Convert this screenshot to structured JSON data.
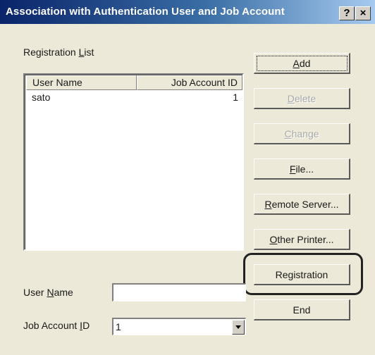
{
  "window": {
    "title": "Association with Authentication User and Job Account",
    "help_symbol": "?",
    "close_symbol": "×"
  },
  "registration_list": {
    "label_pre": "Registration ",
    "label_accel": "L",
    "label_post": "ist",
    "columns": [
      "User Name",
      "Job Account ID"
    ],
    "rows": [
      {
        "user_name": "sato",
        "job_account_id": "1"
      }
    ]
  },
  "buttons": {
    "add": {
      "pre": "",
      "accel": "A",
      "post": "dd"
    },
    "delete": {
      "pre": "",
      "accel": "D",
      "post": "elete"
    },
    "change": {
      "pre": "",
      "accel": "C",
      "post": "hange"
    },
    "file": {
      "pre": "",
      "accel": "F",
      "post": "ile..."
    },
    "remote_server": {
      "pre": "",
      "accel": "R",
      "post": "emote Server..."
    },
    "other_printer": {
      "pre": "",
      "accel": "O",
      "post": "ther Printer..."
    },
    "registration": {
      "pre": "Registration",
      "accel": "",
      "post": ""
    },
    "end": {
      "pre": "End",
      "accel": "",
      "post": ""
    }
  },
  "form": {
    "user_name_label": {
      "pre": "User ",
      "accel": "N",
      "post": "ame"
    },
    "user_name_value": "",
    "job_account_id_label": {
      "pre": "Job Account ",
      "accel": "I",
      "post": "D"
    },
    "job_account_id_value": "1"
  },
  "colors": {
    "title_gradient_start": "#0a246a",
    "title_gradient_end": "#a6caf0",
    "dialog_face": "#ece9d8",
    "highlight_box": "#222222"
  }
}
